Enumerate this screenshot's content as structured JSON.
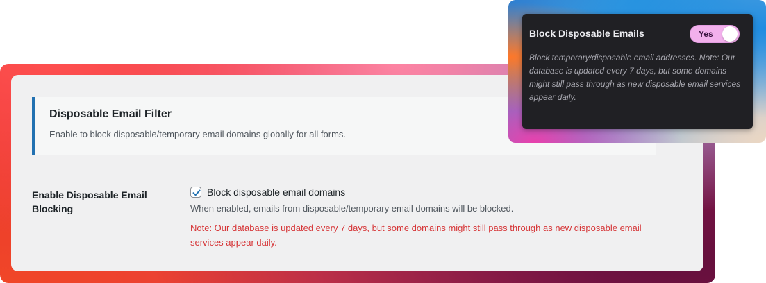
{
  "settings": {
    "section_title": "Disposable Email Filter",
    "section_description": "Enable to block disposable/temporary email domains globally for all forms.",
    "field_label": "Enable Disposable Email Blocking",
    "checkbox_checked": true,
    "checkbox_label": "Block disposable email domains",
    "help_text": "When enabled, emails from disposable/temporary email domains will be blocked.",
    "note_text": "Note: Our database is updated every 7 days, but some domains might still pass through as new disposable email services appear daily."
  },
  "popup": {
    "title": "Block Disposable Emails",
    "toggle_label": "Yes",
    "toggle_on": true,
    "description": "Block temporary/disposable email addresses. Note: Our database is updated every 7 days, but some domains might still pass through as new disposable email services appear daily."
  },
  "colors": {
    "accent_border": "#2271b1",
    "note_red": "#d63638",
    "toggle_bg": "#f2b0ec",
    "popup_bg": "#202024"
  },
  "icons": {
    "checkbox_check": "checkmark-icon"
  }
}
